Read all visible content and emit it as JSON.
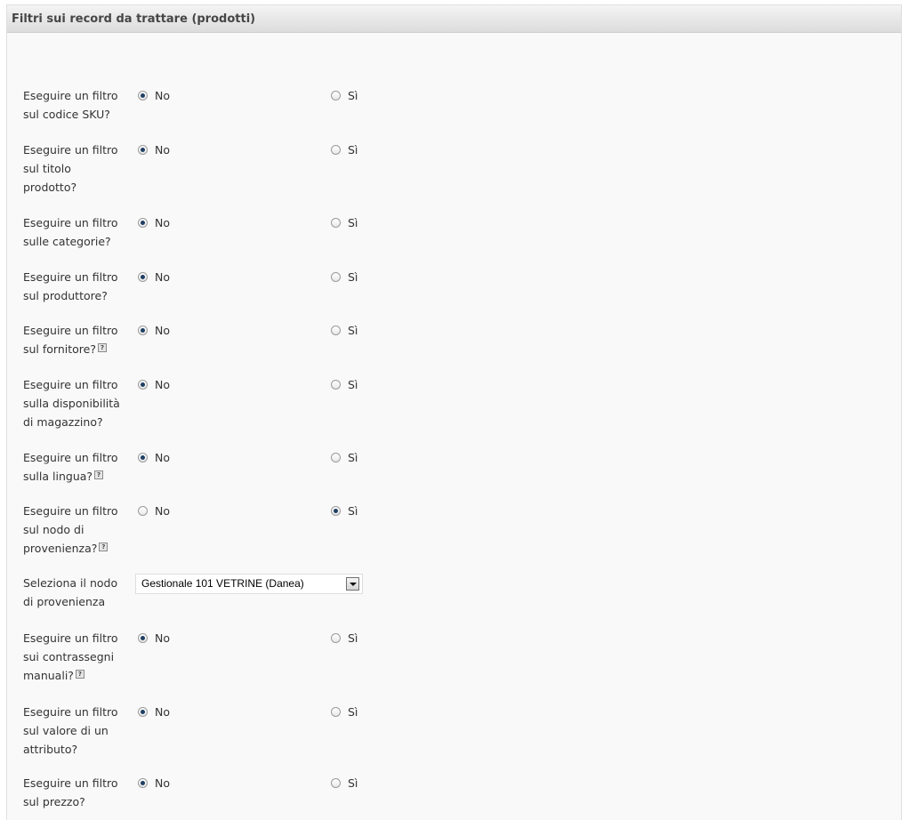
{
  "panel": {
    "title": "Filtri sui record da trattare (prodotti)"
  },
  "options": {
    "no": "No",
    "si": "Sì"
  },
  "rows": [
    {
      "lines": [
        "Eseguire un filtro",
        "sul codice SKU?"
      ],
      "help": false,
      "selected": "no"
    },
    {
      "lines": [
        "Eseguire un filtro",
        "sul titolo",
        "prodotto?"
      ],
      "help": false,
      "selected": "no"
    },
    {
      "lines": [
        "Eseguire un filtro",
        "sulle categorie?"
      ],
      "help": false,
      "selected": "no"
    },
    {
      "lines": [
        "Eseguire un filtro",
        "sul produttore?"
      ],
      "help": false,
      "selected": "no"
    },
    {
      "lines": [
        "Eseguire un filtro",
        "sul fornitore?"
      ],
      "help": true,
      "selected": "no"
    },
    {
      "lines": [
        "Eseguire un filtro",
        "sulla disponibilità",
        "di magazzino?"
      ],
      "help": false,
      "selected": "no"
    },
    {
      "lines": [
        "Eseguire un filtro",
        "sulla lingua?"
      ],
      "help": true,
      "selected": "no"
    },
    {
      "lines": [
        "Eseguire un filtro",
        "sul nodo di",
        "provenienza?"
      ],
      "help": true,
      "selected": "si"
    },
    {
      "lines": [
        "Seleziona il nodo",
        "di provenienza"
      ],
      "type": "select",
      "value": "Gestionale 101 VETRINE (Danea)"
    },
    {
      "lines": [
        "Eseguire un filtro",
        "sui contrassegni",
        "manuali?"
      ],
      "help": true,
      "selected": "no"
    },
    {
      "lines": [
        "Eseguire un filtro",
        "sul valore di un",
        "attributo?"
      ],
      "help": false,
      "selected": "no"
    },
    {
      "lines": [
        "Eseguire un filtro",
        "sul prezzo?"
      ],
      "help": false,
      "selected": "no"
    }
  ],
  "icons": {
    "help": "?"
  }
}
